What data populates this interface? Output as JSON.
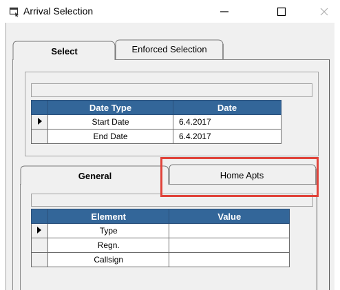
{
  "window": {
    "title": "Arrival Selection",
    "icon": "app-window-icon",
    "controls": {
      "minimize": "minimize-icon",
      "maximize": "maximize-icon",
      "close": "close-icon"
    }
  },
  "tabs_top": [
    {
      "label": "Select",
      "active": true
    },
    {
      "label": "Enforced Selection",
      "active": false
    }
  ],
  "date_grid": {
    "headers": [
      "Date Type",
      "Date"
    ],
    "rows": [
      {
        "type": "Start Date",
        "date": "6.4.2017",
        "current": true
      },
      {
        "type": "End Date",
        "date": "6.4.2017",
        "current": false
      }
    ]
  },
  "tabs_inner": [
    {
      "label": "General",
      "active": true
    },
    {
      "label": "Home Apts",
      "active": false,
      "highlighted": true
    }
  ],
  "element_grid": {
    "headers": [
      "Element",
      "Value"
    ],
    "rows": [
      {
        "element": "Type",
        "value": "",
        "current": true
      },
      {
        "element": "Regn.",
        "value": "",
        "current": false
      },
      {
        "element": "Callsign",
        "value": "",
        "current": false
      }
    ]
  },
  "colors": {
    "grid_header": "#336699",
    "highlight": "#e0433a",
    "background": "#f0f0f0"
  }
}
